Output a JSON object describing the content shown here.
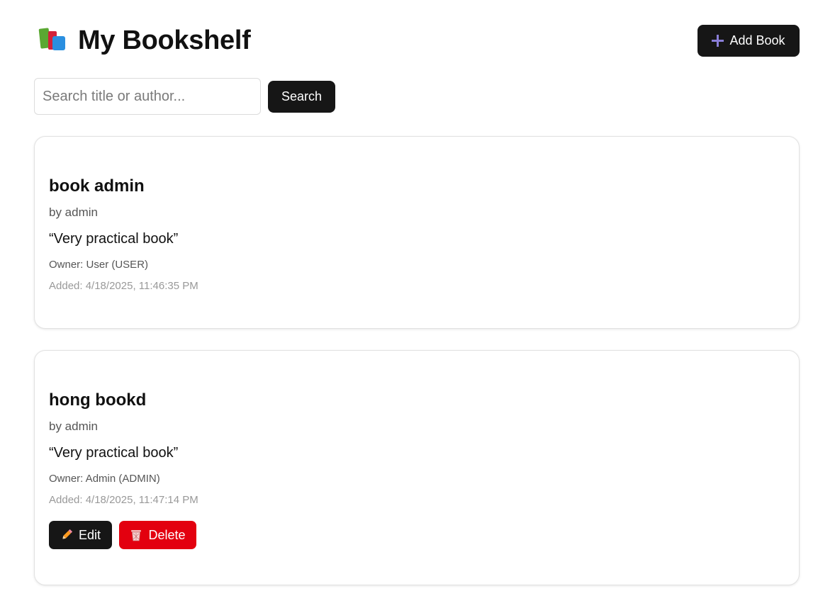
{
  "header": {
    "title": "My Bookshelf",
    "add_button_label": "Add Book"
  },
  "search": {
    "placeholder": "Search title or author...",
    "value": "",
    "button_label": "Search"
  },
  "books": [
    {
      "title": "book admin",
      "author": "by admin",
      "quote": "“Very practical book”",
      "owner": "Owner: User (USER)",
      "added": "Added: 4/18/2025, 11:46:35 PM"
    },
    {
      "title": "hong bookd",
      "author": "by admin",
      "quote": "“Very practical book”",
      "owner": "Owner: Admin (ADMIN)",
      "added": "Added: 4/18/2025, 11:47:14 PM",
      "edit_label": "Edit",
      "delete_label": "Delete"
    }
  ],
  "icons": {
    "title_icon": "books-icon",
    "add_icon": "plus-icon",
    "edit_icon": "pencil-icon",
    "delete_icon": "trash-icon"
  },
  "colors": {
    "primary_button": "#161616",
    "delete_button": "#e3000f",
    "plus_icon": "#8a7ed8"
  }
}
